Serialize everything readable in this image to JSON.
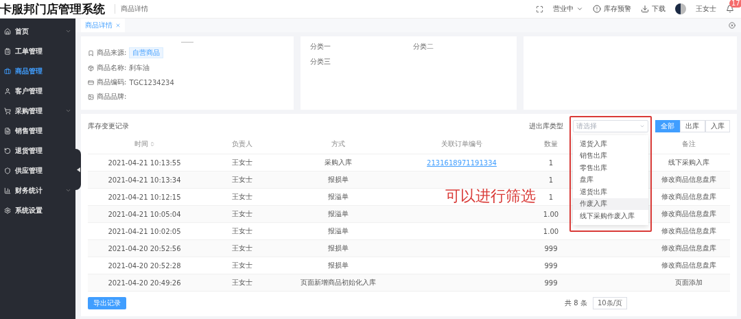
{
  "header": {
    "logo": "卡服邦门店管理系统",
    "breadcrumb": "商品详情",
    "status": "营业中",
    "actions": [
      {
        "kind": "alert",
        "label": "库存预警"
      },
      {
        "kind": "download",
        "label": "下载"
      }
    ],
    "user": "王女士",
    "notifications": "17"
  },
  "sidebar": {
    "items": [
      {
        "label": "首页",
        "selected": false,
        "submenu": true
      },
      {
        "label": "工单管理",
        "selected": false,
        "submenu": false
      },
      {
        "label": "商品管理",
        "selected": true,
        "submenu": false
      },
      {
        "label": "客户管理",
        "selected": false,
        "submenu": false
      },
      {
        "label": "采购管理",
        "selected": false,
        "submenu": true
      },
      {
        "label": "销售管理",
        "selected": false,
        "submenu": false
      },
      {
        "label": "退货管理",
        "selected": false,
        "submenu": false
      },
      {
        "label": "供应管理",
        "selected": false,
        "submenu": false
      },
      {
        "label": "财务统计",
        "selected": false,
        "submenu": true
      },
      {
        "label": "系统设置",
        "selected": false,
        "submenu": false
      }
    ]
  },
  "tabs": [
    {
      "label": "商品详情",
      "selected": true
    }
  ],
  "info": {
    "fields": [
      {
        "label": "商品来源:",
        "tag": "自营商品"
      },
      {
        "label": "商品名称:",
        "value": "刹车油"
      },
      {
        "label": "商品编码:",
        "value": "TGC1234234"
      },
      {
        "label": "商品品牌:"
      }
    ],
    "categories": [
      "分类一",
      "分类二",
      "分类三"
    ]
  },
  "records": {
    "title": "库存变更记录",
    "filter": {
      "label": "进出库类型",
      "placeholder": "请选择",
      "options": [
        {
          "label": "退货入库",
          "selected": false
        },
        {
          "label": "销售出库",
          "selected": false
        },
        {
          "label": "零售出库",
          "selected": false
        },
        {
          "label": "盘库",
          "selected": false
        },
        {
          "label": "退货出库",
          "selected": false
        },
        {
          "label": "作废入库",
          "selected": true
        },
        {
          "label": "线下采购作废入库",
          "selected": false
        }
      ]
    },
    "segments": [
      {
        "label": "全部",
        "selected": true
      },
      {
        "label": "出库",
        "selected": false
      },
      {
        "label": "入库",
        "selected": false
      }
    ],
    "columns": [
      {
        "label": "时间",
        "sortable": true
      },
      {
        "label": "负责人",
        "sortable": false
      },
      {
        "label": "方式",
        "sortable": false
      },
      {
        "label": "关联订单编号",
        "sortable": false
      },
      {
        "label": "数量",
        "sortable": false
      },
      {
        "label": "备注",
        "sortable": false
      }
    ],
    "rows": [
      {
        "time": "2021-04-21 10:13:55",
        "person": "王女士",
        "method": "采购入库",
        "order": "2131618971191334",
        "qty": "1",
        "note": "线下采购入库"
      },
      {
        "time": "2021-04-21 10:13:34",
        "person": "王女士",
        "method": "报损单",
        "qty": "1",
        "note": "修改商品信息盘库"
      },
      {
        "time": "2021-04-21 10:12:15",
        "person": "王女士",
        "method": "报溢单",
        "qty": "1",
        "note": "修改商品信息盘库"
      },
      {
        "time": "2021-04-21 10:05:04",
        "person": "王女士",
        "method": "报溢单",
        "qty": "1.00",
        "note": "修改商品信息盘库"
      },
      {
        "time": "2021-04-21 10:02:05",
        "person": "王女士",
        "method": "报溢单",
        "qty": "1.00",
        "note": "修改商品信息盘库"
      },
      {
        "time": "2021-04-20 20:52:56",
        "person": "王女士",
        "method": "报损单",
        "qty": "999",
        "note": "修改商品信息盘库"
      },
      {
        "time": "2021-04-20 20:52:28",
        "person": "王女士",
        "method": "报损单",
        "qty": "999",
        "note": "修改商品信息盘库"
      },
      {
        "time": "2021-04-20 20:49:26",
        "person": "王女士",
        "method": "页面新增商品初始化入库",
        "qty": "999",
        "note": "页面添加"
      }
    ],
    "export": "导出记录",
    "total": "共 8 条",
    "page_size": "10条/页"
  },
  "annotation": "可以进行筛选"
}
